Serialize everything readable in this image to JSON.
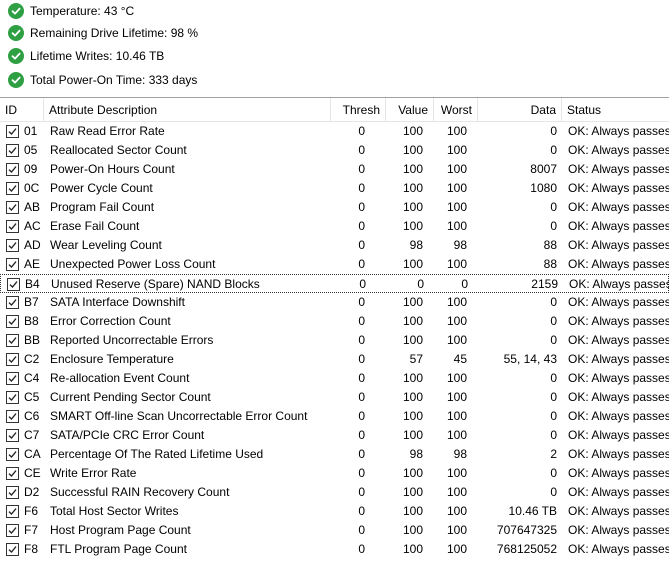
{
  "summary": [
    {
      "icon": "check-circle-icon",
      "text": "Temperature: 43 °C"
    },
    {
      "icon": "check-circle-icon",
      "text": "Remaining Drive Lifetime: 98 %"
    },
    {
      "icon": "check-circle-icon",
      "text": "Lifetime Writes: 10.46 TB"
    },
    {
      "icon": "check-circle-icon",
      "text": "Total Power-On Time: 333 days"
    }
  ],
  "colors": {
    "ok": "#2ea043",
    "divider": "#a0a0a0"
  },
  "table": {
    "headers": {
      "id": "ID",
      "desc": "Attribute Description",
      "thresh": "Thresh",
      "value": "Value",
      "worst": "Worst",
      "data": "Data",
      "status": "Status"
    },
    "rows": [
      {
        "id": "01",
        "desc": "Raw Read Error Rate",
        "thresh": "0",
        "value": "100",
        "worst": "100",
        "data": "0",
        "status": "OK: Always passes",
        "checked": true
      },
      {
        "id": "05",
        "desc": "Reallocated Sector Count",
        "thresh": "0",
        "value": "100",
        "worst": "100",
        "data": "0",
        "status": "OK: Always passes",
        "checked": true
      },
      {
        "id": "09",
        "desc": "Power-On Hours Count",
        "thresh": "0",
        "value": "100",
        "worst": "100",
        "data": "8007",
        "status": "OK: Always passes",
        "checked": true
      },
      {
        "id": "0C",
        "desc": "Power Cycle Count",
        "thresh": "0",
        "value": "100",
        "worst": "100",
        "data": "1080",
        "status": "OK: Always passes",
        "checked": true
      },
      {
        "id": "AB",
        "desc": "Program Fail Count",
        "thresh": "0",
        "value": "100",
        "worst": "100",
        "data": "0",
        "status": "OK: Always passes",
        "checked": true
      },
      {
        "id": "AC",
        "desc": "Erase Fail Count",
        "thresh": "0",
        "value": "100",
        "worst": "100",
        "data": "0",
        "status": "OK: Always passes",
        "checked": true
      },
      {
        "id": "AD",
        "desc": "Wear Leveling Count",
        "thresh": "0",
        "value": "98",
        "worst": "98",
        "data": "88",
        "status": "OK: Always passes",
        "checked": true
      },
      {
        "id": "AE",
        "desc": "Unexpected Power Loss Count",
        "thresh": "0",
        "value": "100",
        "worst": "100",
        "data": "88",
        "status": "OK: Always passes",
        "checked": true
      },
      {
        "id": "B4",
        "desc": "Unused Reserve (Spare) NAND Blocks",
        "thresh": "0",
        "value": "0",
        "worst": "0",
        "data": "2159",
        "status": "OK: Always passes",
        "checked": true,
        "selected": true
      },
      {
        "id": "B7",
        "desc": "SATA Interface Downshift",
        "thresh": "0",
        "value": "100",
        "worst": "100",
        "data": "0",
        "status": "OK: Always passes",
        "checked": true
      },
      {
        "id": "B8",
        "desc": "Error Correction Count",
        "thresh": "0",
        "value": "100",
        "worst": "100",
        "data": "0",
        "status": "OK: Always passes",
        "checked": true
      },
      {
        "id": "BB",
        "desc": "Reported Uncorrectable Errors",
        "thresh": "0",
        "value": "100",
        "worst": "100",
        "data": "0",
        "status": "OK: Always passes",
        "checked": true
      },
      {
        "id": "C2",
        "desc": "Enclosure Temperature",
        "thresh": "0",
        "value": "57",
        "worst": "45",
        "data": "55, 14, 43",
        "status": "OK: Always passes",
        "checked": true
      },
      {
        "id": "C4",
        "desc": "Re-allocation Event Count",
        "thresh": "0",
        "value": "100",
        "worst": "100",
        "data": "0",
        "status": "OK: Always passes",
        "checked": true
      },
      {
        "id": "C5",
        "desc": "Current Pending Sector Count",
        "thresh": "0",
        "value": "100",
        "worst": "100",
        "data": "0",
        "status": "OK: Always passes",
        "checked": true
      },
      {
        "id": "C6",
        "desc": "SMART Off-line Scan Uncorrectable Error Count",
        "thresh": "0",
        "value": "100",
        "worst": "100",
        "data": "0",
        "status": "OK: Always passes",
        "checked": true
      },
      {
        "id": "C7",
        "desc": "SATA/PCIe CRC Error Count",
        "thresh": "0",
        "value": "100",
        "worst": "100",
        "data": "0",
        "status": "OK: Always passes",
        "checked": true
      },
      {
        "id": "CA",
        "desc": "Percentage Of The Rated Lifetime Used",
        "thresh": "0",
        "value": "98",
        "worst": "98",
        "data": "2",
        "status": "OK: Always passes",
        "checked": true
      },
      {
        "id": "CE",
        "desc": "Write Error Rate",
        "thresh": "0",
        "value": "100",
        "worst": "100",
        "data": "0",
        "status": "OK: Always passes",
        "checked": true
      },
      {
        "id": "D2",
        "desc": "Successful RAIN Recovery Count",
        "thresh": "0",
        "value": "100",
        "worst": "100",
        "data": "0",
        "status": "OK: Always passes",
        "checked": true
      },
      {
        "id": "F6",
        "desc": "Total Host Sector Writes",
        "thresh": "0",
        "value": "100",
        "worst": "100",
        "data": "10.46 TB",
        "status": "OK: Always passes",
        "checked": true
      },
      {
        "id": "F7",
        "desc": "Host Program Page Count",
        "thresh": "0",
        "value": "100",
        "worst": "100",
        "data": "707647325",
        "status": "OK: Always passes",
        "checked": true
      },
      {
        "id": "F8",
        "desc": "FTL Program Page Count",
        "thresh": "0",
        "value": "100",
        "worst": "100",
        "data": "768125052",
        "status": "OK: Always passes",
        "checked": true
      }
    ]
  }
}
